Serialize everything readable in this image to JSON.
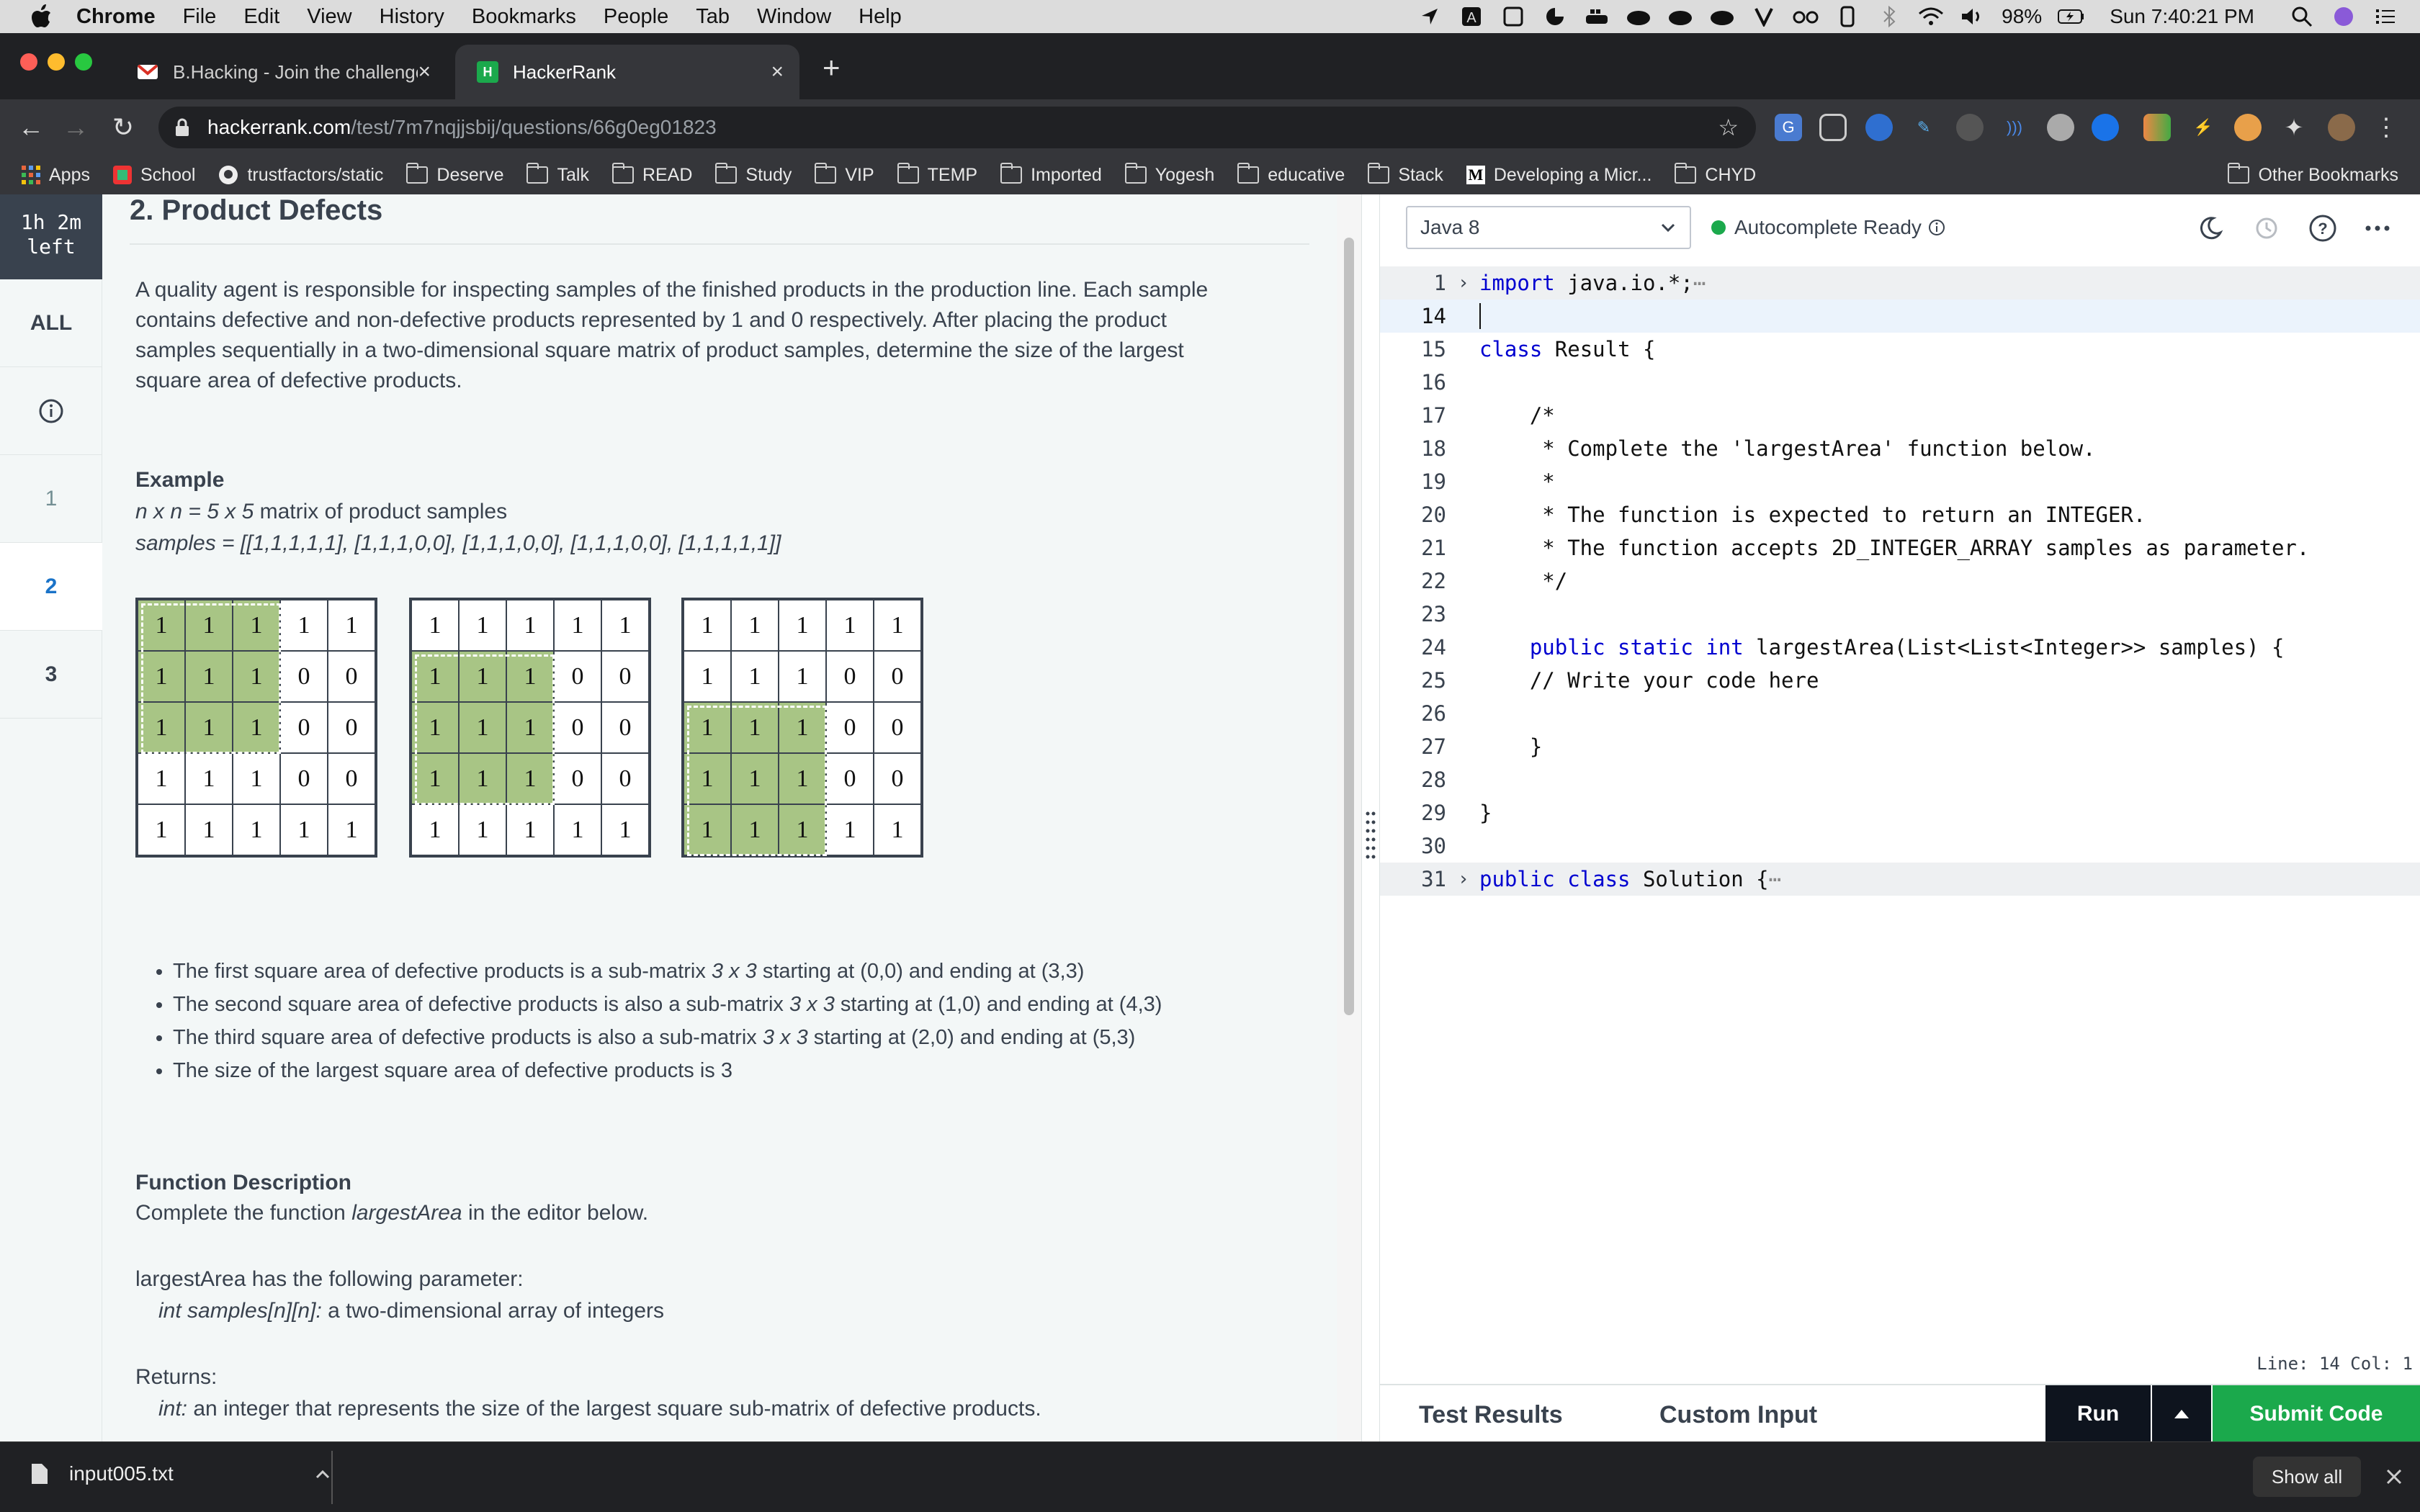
{
  "menubar": {
    "app": "Chrome",
    "items": [
      "File",
      "Edit",
      "View",
      "History",
      "Bookmarks",
      "People",
      "Tab",
      "Window",
      "Help"
    ],
    "battery": "98%",
    "clock": "Sun 7:40:21 PM"
  },
  "tabs": [
    {
      "title": "B.Hacking - Join the challenge"
    },
    {
      "title": "HackerRank"
    }
  ],
  "address": {
    "domain": "hackerrank.com",
    "path": "/test/7m7nqjjsbij/questions/66g0eg01823"
  },
  "bookmarks": [
    "Apps",
    "School",
    "trustfactors/static",
    "Deserve",
    "Talk",
    "READ",
    "Study",
    "VIP",
    "TEMP",
    "Imported",
    "Yogesh",
    "educative",
    "Stack",
    "Developing a Micr...",
    "CHYD"
  ],
  "other_bookmarks": "Other Bookmarks",
  "leftnav": {
    "timer": "1h 2m left",
    "all": "ALL",
    "q1": "1",
    "q2": "2",
    "q3": "3"
  },
  "problem": {
    "title": "2. Product Defects",
    "desc1": "A quality agent is responsible for inspecting samples of the finished products in the production line. Each sample",
    "desc2": "contains defective and non-defective products represented by 1 and 0 respectively.  After placing the product",
    "desc3": "samples sequentially in a two-dimensional square matrix of product samples, determine the size of the largest",
    "desc4": "square area of defective products.",
    "example_label": "Example",
    "example_nxn": "n x n = 5 x 5",
    "example_nxn_rest": " matrix of product samples",
    "example_samples": "samples = [[1,1,1,1,1], [1,1,1,0,0], [1,1,1,0,0], [1,1,1,0,0], [1,1,1,1,1]]",
    "bullets": [
      {
        "a": "The first square area of defective products is a sub-matrix ",
        "b": "3 x 3",
        "c": " starting at (0,0) and ending at (3,3)"
      },
      {
        "a": "The second square area of defective products is also a sub-matrix ",
        "b": "3 x 3",
        "c": " starting at (1,0) and ending at (4,3)"
      },
      {
        "a": "The third square area of defective products is also a sub-matrix ",
        "b": "3 x 3",
        "c": " starting at (2,0) and ending at (5,3)"
      },
      {
        "a": "The size of the largest square area of defective products is 3",
        "b": "",
        "c": ""
      }
    ],
    "fd_label": "Function Description",
    "fd_text_a": "Complete the function ",
    "fd_text_b": "largestArea",
    "fd_text_c": " in the editor below.",
    "param_intro": "largestArea has the following parameter:",
    "param_a": "int samples[n][n]:",
    "param_b": "  a two-dimensional array of integers",
    "returns_label": "Returns:",
    "returns_a": "int:",
    "returns_b": " an integer that represents the size of the largest square sub-matrix of defective products."
  },
  "matrices": [
    {
      "rows": [
        [
          1,
          1,
          1,
          1,
          1
        ],
        [
          1,
          1,
          1,
          0,
          0
        ],
        [
          1,
          1,
          1,
          0,
          0
        ],
        [
          1,
          1,
          1,
          0,
          0
        ],
        [
          1,
          1,
          1,
          1,
          1
        ]
      ],
      "highlight_start_row": 0
    },
    {
      "rows": [
        [
          1,
          1,
          1,
          1,
          1
        ],
        [
          1,
          1,
          1,
          0,
          0
        ],
        [
          1,
          1,
          1,
          0,
          0
        ],
        [
          1,
          1,
          1,
          0,
          0
        ],
        [
          1,
          1,
          1,
          1,
          1
        ]
      ],
      "highlight_start_row": 1
    },
    {
      "rows": [
        [
          1,
          1,
          1,
          1,
          1
        ],
        [
          1,
          1,
          1,
          0,
          0
        ],
        [
          1,
          1,
          1,
          0,
          0
        ],
        [
          1,
          1,
          1,
          0,
          0
        ],
        [
          1,
          1,
          1,
          1,
          1
        ]
      ],
      "highlight_start_row": 2
    }
  ],
  "editor": {
    "language": "Java 8",
    "autocomplete": "Autocomplete Ready",
    "status": "Line: 14 Col: 1",
    "lines": [
      {
        "n": "1",
        "fold": true
      },
      {
        "n": "14",
        "cur": true
      },
      {
        "n": "15"
      },
      {
        "n": "16"
      },
      {
        "n": "17"
      },
      {
        "n": "18"
      },
      {
        "n": "19"
      },
      {
        "n": "20"
      },
      {
        "n": "21"
      },
      {
        "n": "22"
      },
      {
        "n": "23"
      },
      {
        "n": "24"
      },
      {
        "n": "25"
      },
      {
        "n": "26"
      },
      {
        "n": "27"
      },
      {
        "n": "28"
      },
      {
        "n": "29"
      },
      {
        "n": "30"
      },
      {
        "n": "31",
        "fold": true
      }
    ],
    "code": {
      "l1_kw": "import",
      "l1_rest": " java.io.*;",
      "l1_ellipsis": "⋯",
      "l15_kw": "class",
      "l15_rest": " Result {",
      "l17": "    /*",
      "l18": "     * Complete the 'largestArea' function below.",
      "l19": "     *",
      "l20": "     * The function is expected to return an INTEGER.",
      "l21": "     * The function accepts 2D_INTEGER_ARRAY samples as parameter.",
      "l22": "     */",
      "l24_indent": "    ",
      "l24_kw": "public static int",
      "l24_rest": " largestArea(List<List<Integer>> samples) {",
      "l25": "    // Write your code here",
      "l27": "    }",
      "l29": "}",
      "l31_kw": "public class",
      "l31_rest": " Solution {",
      "l31_ellipsis": "⋯"
    },
    "bottom_tabs": [
      "Test Results",
      "Custom Input"
    ],
    "run": "Run",
    "submit": "Submit Code"
  },
  "downloads": {
    "file": "input005.txt",
    "show_all": "Show all"
  }
}
